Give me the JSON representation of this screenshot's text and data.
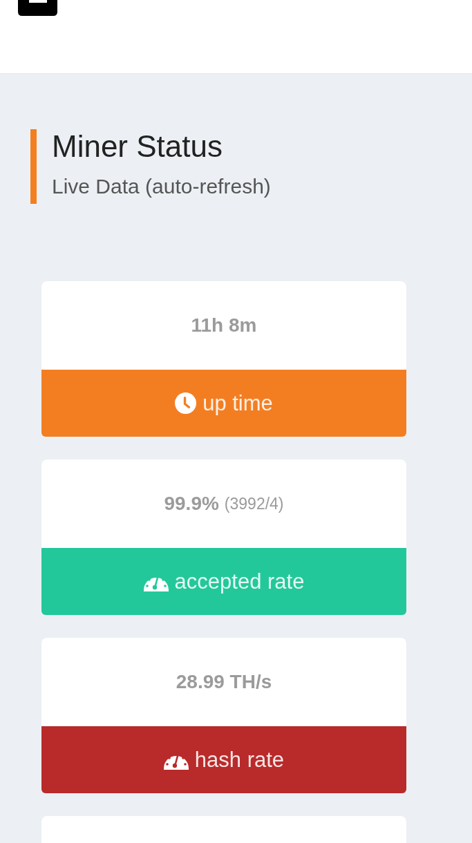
{
  "section": {
    "title": "Miner Status",
    "subtitle": "Live Data (auto-refresh)"
  },
  "stats": [
    {
      "kind": "time",
      "value": "11h 8m",
      "label": "up time",
      "color": "#f37e22"
    },
    {
      "kind": "rate",
      "value": "99.9%",
      "detail": "(3992/4)",
      "label": "accepted rate",
      "color": "#22c89a"
    },
    {
      "kind": "rate",
      "value": "28.99 TH/s",
      "label": "hash rate",
      "color": "#b92a2a"
    },
    {
      "kind": "blank"
    }
  ]
}
